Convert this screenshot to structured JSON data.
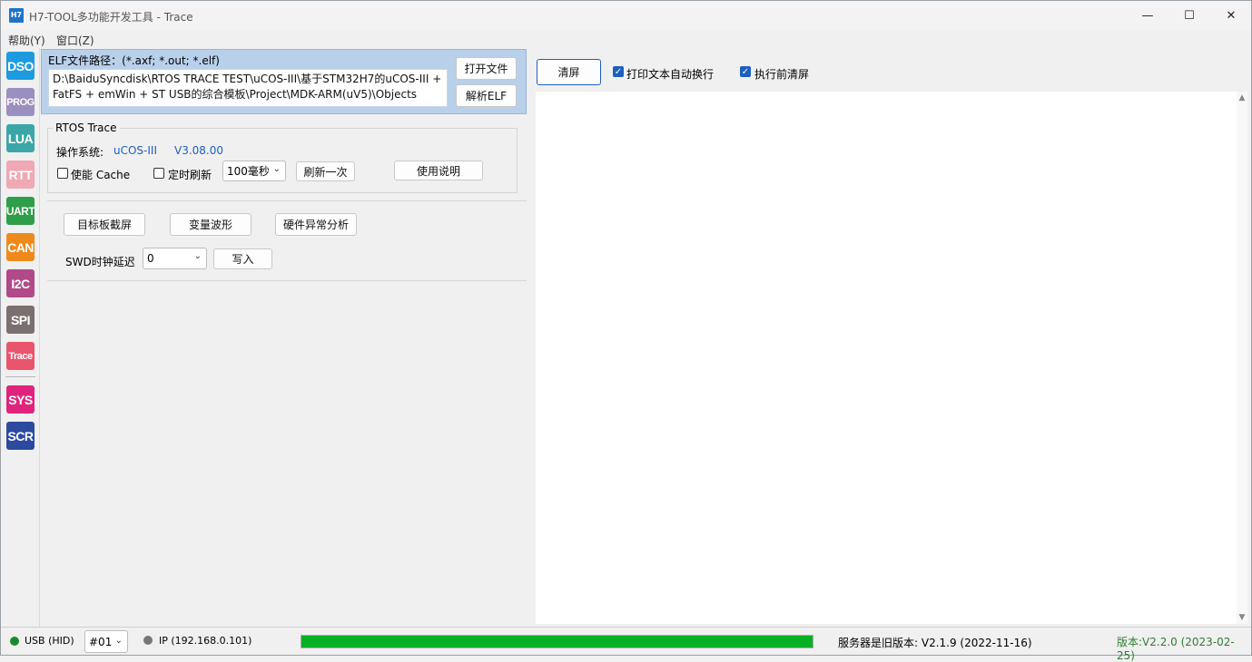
{
  "window": {
    "title": "H7-TOOL多功能开发工具 - Trace",
    "app_icon_text": "H7",
    "minimize": "—",
    "maximize": "☐",
    "close": "✕"
  },
  "menu": [
    {
      "label": "帮助(Y)"
    },
    {
      "label": "窗口(Z)"
    }
  ],
  "toolbar": [
    {
      "label": "DSO",
      "color": "#1e9be0"
    },
    {
      "label": "PROG",
      "color": "#9b8fbf"
    },
    {
      "label": "LUA",
      "color": "#3aa6a8"
    },
    {
      "label": "RTT",
      "color": "#f0a8b4"
    },
    {
      "label": "UART",
      "color": "#2e9e49"
    },
    {
      "label": "CAN",
      "color": "#ee8a1c"
    },
    {
      "label": "I2C",
      "color": "#b04a88"
    },
    {
      "label": "SPI",
      "color": "#7a7070"
    },
    {
      "label": "Trace",
      "color": "#e8556c"
    },
    {
      "label": "SYS",
      "color": "#e0247e"
    },
    {
      "label": "SCR",
      "color": "#2c4aa0"
    }
  ],
  "elf": {
    "label": "ELF文件路径：(*.axf; *.out; *.elf)",
    "path": "D:\\BaiduSyncdisk\\RTOS TRACE TEST\\uCOS-III\\基于STM32H7的uCOS-III + FatFS + emWin + ST USB的综合模板\\Project\\MDK-ARM(uV5)\\Objects",
    "open_button": "打开文件",
    "parse_button": "解析ELF"
  },
  "rtos": {
    "group_title": "RTOS Trace",
    "os_label": "操作系统:",
    "os_name": "uCOS-III",
    "os_version": "V3.08.00",
    "enable_cache_label": "使能 Cache",
    "enable_cache_checked": false,
    "timed_refresh_label": "定时刷新",
    "timed_refresh_checked": false,
    "interval_value": "100毫秒",
    "refresh_once_button": "刷新一次",
    "help_button": "使用说明"
  },
  "tools": {
    "screenshot_button": "目标板截屏",
    "wave_button": "变量波形",
    "fault_button": "硬件异常分析",
    "swd_label": "SWD时钟延迟",
    "swd_value": "0",
    "write_button": "写入"
  },
  "output": {
    "clear_button": "清屏",
    "wrap_label": "打印文本自动换行",
    "wrap_checked": true,
    "clear_before_label": "执行前清屏",
    "clear_before_checked": true
  },
  "status": {
    "usb_label": "USB (HID)",
    "usb_color": "#1a8a2e",
    "device_value": "#01",
    "ip_label": "IP (192.168.0.101)",
    "ip_color": "#777777",
    "progress": 1.0,
    "server_version": "服务器是旧版本: V2.1.9 (2022-11-16)",
    "app_version": "版本:V2.2.0 (2023-02-25)",
    "app_version_color": "#2e7d32"
  }
}
